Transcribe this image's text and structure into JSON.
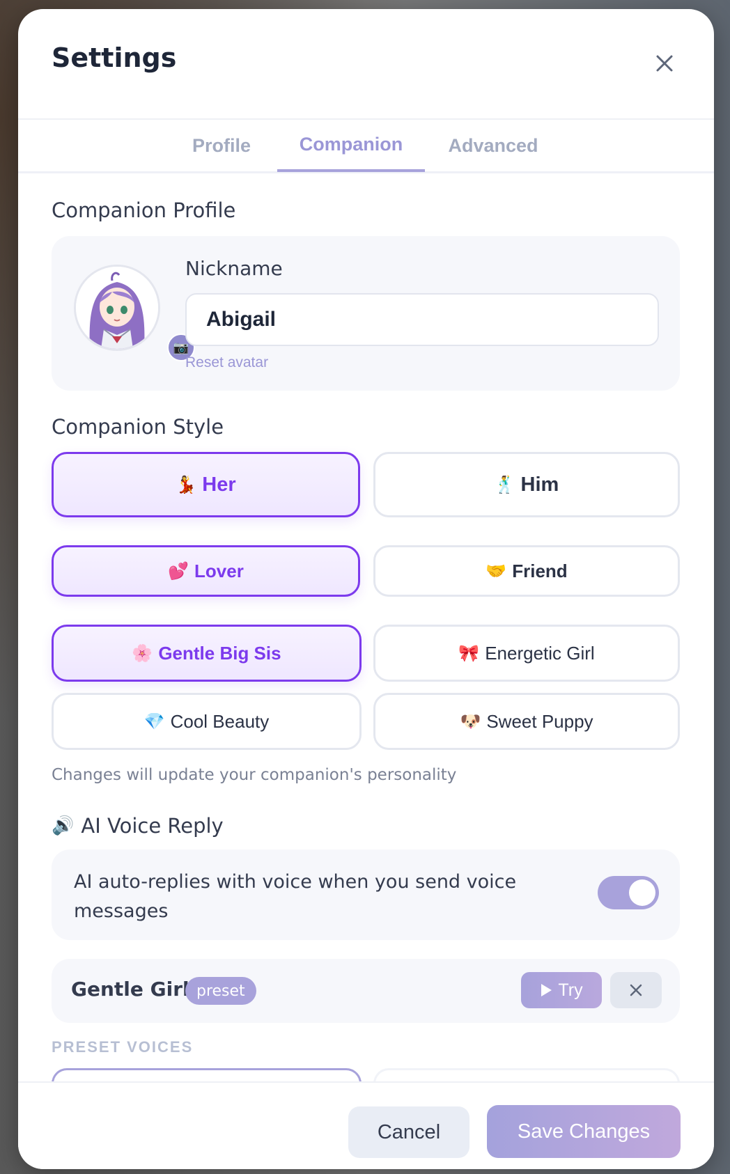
{
  "header": {
    "title": "Settings"
  },
  "tabs": [
    {
      "label": "Profile",
      "active": false
    },
    {
      "label": "Companion",
      "active": true
    },
    {
      "label": "Advanced",
      "active": false
    }
  ],
  "companion_profile": {
    "section_title": "Companion Profile",
    "nickname_label": "Nickname",
    "nickname_value": "Abigail",
    "reset_avatar": "Reset avatar"
  },
  "companion_style": {
    "section_title": "Companion Style",
    "gender": [
      {
        "emoji": "💃",
        "label": "Her",
        "selected": true
      },
      {
        "emoji": "🕺",
        "label": "Him",
        "selected": false
      }
    ],
    "relationship": [
      {
        "emoji": "💕",
        "label": "Lover",
        "selected": true
      },
      {
        "emoji": "🤝",
        "label": "Friend",
        "selected": false
      }
    ],
    "personality": [
      {
        "emoji": "🌸",
        "label": "Gentle Big Sis",
        "selected": true
      },
      {
        "emoji": "🎀",
        "label": "Energetic Girl",
        "selected": false
      },
      {
        "emoji": "💎",
        "label": "Cool Beauty",
        "selected": false
      },
      {
        "emoji": "🐶",
        "label": "Sweet Puppy",
        "selected": false
      }
    ],
    "hint": "Changes will update your companion's personality"
  },
  "voice": {
    "section_emoji": "🔊",
    "section_title": "AI Voice Reply",
    "auto_reply_text": "AI auto-replies with voice when you send voice messages",
    "auto_reply_enabled": true,
    "current_voice_name": "Gentle Girl",
    "current_voice_badge": "preset",
    "try_label": "Try",
    "preset_voices_label": "PRESET VOICES"
  },
  "footer": {
    "cancel_label": "Cancel",
    "save_label": "Save Changes"
  },
  "colors": {
    "accent": "#7c3aed",
    "soft_accent": "#a8a2db",
    "text": "#343b4e"
  }
}
